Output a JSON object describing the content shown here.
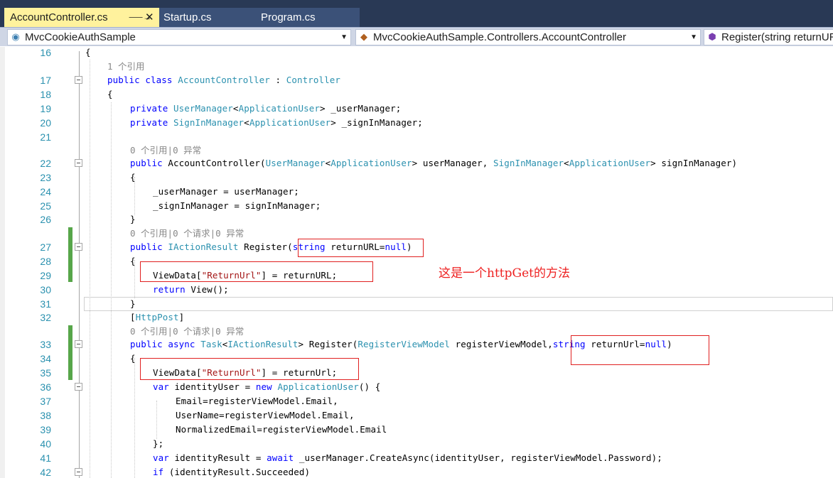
{
  "tabs": [
    {
      "label": "AccountController.cs",
      "active": true,
      "pin_icon": "pin-icon",
      "close_icon": "close-icon"
    },
    {
      "label": "Startup.cs",
      "active": false
    },
    {
      "label": "Program.cs",
      "active": false
    }
  ],
  "navbar": {
    "project": {
      "label": "MvcCookieAuthSample",
      "icon": "project-icon"
    },
    "type": {
      "label": "MvcCookieAuthSample.Controllers.AccountController",
      "icon": "class-icon"
    },
    "member": {
      "label": "Register(string returnURL = null)",
      "icon": "method-icon"
    }
  },
  "code": {
    "line_numbers": [
      "16",
      "17",
      "18",
      "19",
      "20",
      "21",
      "22",
      "23",
      "24",
      "25",
      "26",
      "27",
      "28",
      "29",
      "30",
      "31",
      "32",
      "33",
      "34",
      "35",
      "36",
      "37",
      "38",
      "39",
      "40",
      "41",
      "42"
    ],
    "codelens": {
      "class_refs": "1 个引用",
      "ctor_refs": "0 个引用|0 异常",
      "get_refs": "0 个引用|0 个请求|0 异常",
      "post_refs": "0 个引用|0 个请求|0 异常"
    },
    "tokens": {
      "brace_open": "{",
      "brace_close": "}",
      "bracket_close": "]",
      "public": "public",
      "private": "private",
      "class": "class",
      "async": "async",
      "return": "return",
      "var": "var",
      "new": "new",
      "await": "await",
      "if": "if",
      "string": "string",
      "null": "null",
      "AccountController": "AccountController",
      "Controller": "Controller",
      "UserManager": "UserManager",
      "SignInManager": "SignInManager",
      "ApplicationUser": "ApplicationUser",
      "IActionResult": "IActionResult",
      "Task": "Task",
      "RegisterViewModel": "RegisterViewModel",
      "HttpPost": "HttpPost",
      "ReturnUrl_str": "\"ReturnUrl\""
    },
    "text": {
      "l17_colon": " : ",
      "l19_rest": "> _userManager;",
      "l20_rest": "> _signInManager;",
      "l22_name": "AccountController(",
      "l22_um": "> userManager, ",
      "l22_sm": "> signInManager)",
      "l24": "_userManager = userManager;",
      "l25": "_signInManager = signInManager;",
      "l27_name": " Register(",
      "l27_param": " returnURL=",
      "l27_close": ")",
      "l29_a": "ViewData[",
      "l29_b": "] = returnURL;",
      "l30_rest": " View();",
      "l32_open": "[",
      "l33_lt": "<",
      "l33_name": "> Register(",
      "l33_param1": " registerViewModel,",
      "l33_param2": " returnUrl=",
      "l33_close": ")",
      "l35_b": "] = returnUrl;",
      "l36_a": " identityUser = ",
      "l36_b": "() {",
      "l37": "Email=registerViewModel.Email,",
      "l38": "UserName=registerViewModel.Email,",
      "l39": "NormalizedEmail=registerViewModel.Email",
      "l40": "};",
      "l41_a": " identityResult = ",
      "l41_b": " _userManager.CreateAsync(identityUser, registerViewModel.Password);",
      "l42_a": " (identityResult.Succeeded)"
    }
  },
  "annotation": "这是一个httpGet的方法",
  "colors": {
    "keyword": "#0000ff",
    "type": "#2b91af",
    "string": "#a31515",
    "line_number": "#2b91af",
    "codelens": "#888888",
    "annotation": "#ee2020",
    "change_bar": "#57a64a",
    "active_tab": "#fff29d",
    "tab_strip": "#293955"
  }
}
